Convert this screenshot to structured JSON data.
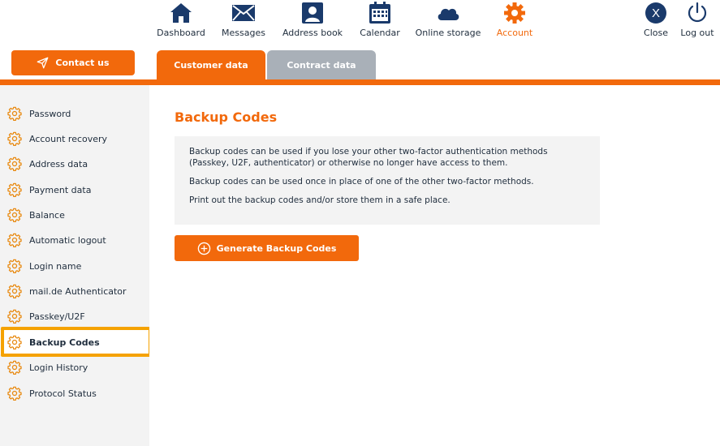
{
  "colors": {
    "accent": "#f2690c",
    "highlight": "#f5a201",
    "inactive_tab": "#a9b0b8",
    "sidebar_bg": "#f3f3f3"
  },
  "contact_button": {
    "label": "Contact us",
    "icon": "paper-plane-icon"
  },
  "topnav": [
    {
      "label": "Dashboard",
      "icon": "home-icon",
      "active": false
    },
    {
      "label": "Messages",
      "icon": "envelope-icon",
      "active": false
    },
    {
      "label": "Address book",
      "icon": "contact-book-icon",
      "active": false
    },
    {
      "label": "Calendar",
      "icon": "calendar-icon",
      "active": false
    },
    {
      "label": "Online storage",
      "icon": "cloud-icon",
      "active": false
    },
    {
      "label": "Account",
      "icon": "gear-icon",
      "active": true
    }
  ],
  "top_actions": [
    {
      "label": "Close",
      "icon": "close-circle-icon"
    },
    {
      "label": "Log out",
      "icon": "power-icon"
    }
  ],
  "tabs": [
    {
      "label": "Customer data",
      "active": true
    },
    {
      "label": "Contract data",
      "active": false
    }
  ],
  "sidebar": {
    "items": [
      {
        "label": "Password"
      },
      {
        "label": "Account recovery"
      },
      {
        "label": "Address data"
      },
      {
        "label": "Payment data"
      },
      {
        "label": "Balance"
      },
      {
        "label": "Automatic logout"
      },
      {
        "label": "Login name"
      },
      {
        "label": "mail.de Authenticator"
      },
      {
        "label": "Passkey/U2F"
      },
      {
        "label": "Backup Codes",
        "active": true
      },
      {
        "label": "Login History"
      },
      {
        "label": "Protocol Status"
      }
    ]
  },
  "main": {
    "title": "Backup Codes",
    "info": [
      "Backup codes can be used if you lose your other two-factor authentication methods (Passkey, U2F, authenticator) or otherwise no longer have access to them.",
      "Backup codes can be used once in place of one of the other two-factor methods.",
      "Print out the backup codes and/or store them in a safe place."
    ],
    "generate_button": {
      "label": "Generate Backup Codes",
      "icon": "plus-circle-icon"
    }
  }
}
